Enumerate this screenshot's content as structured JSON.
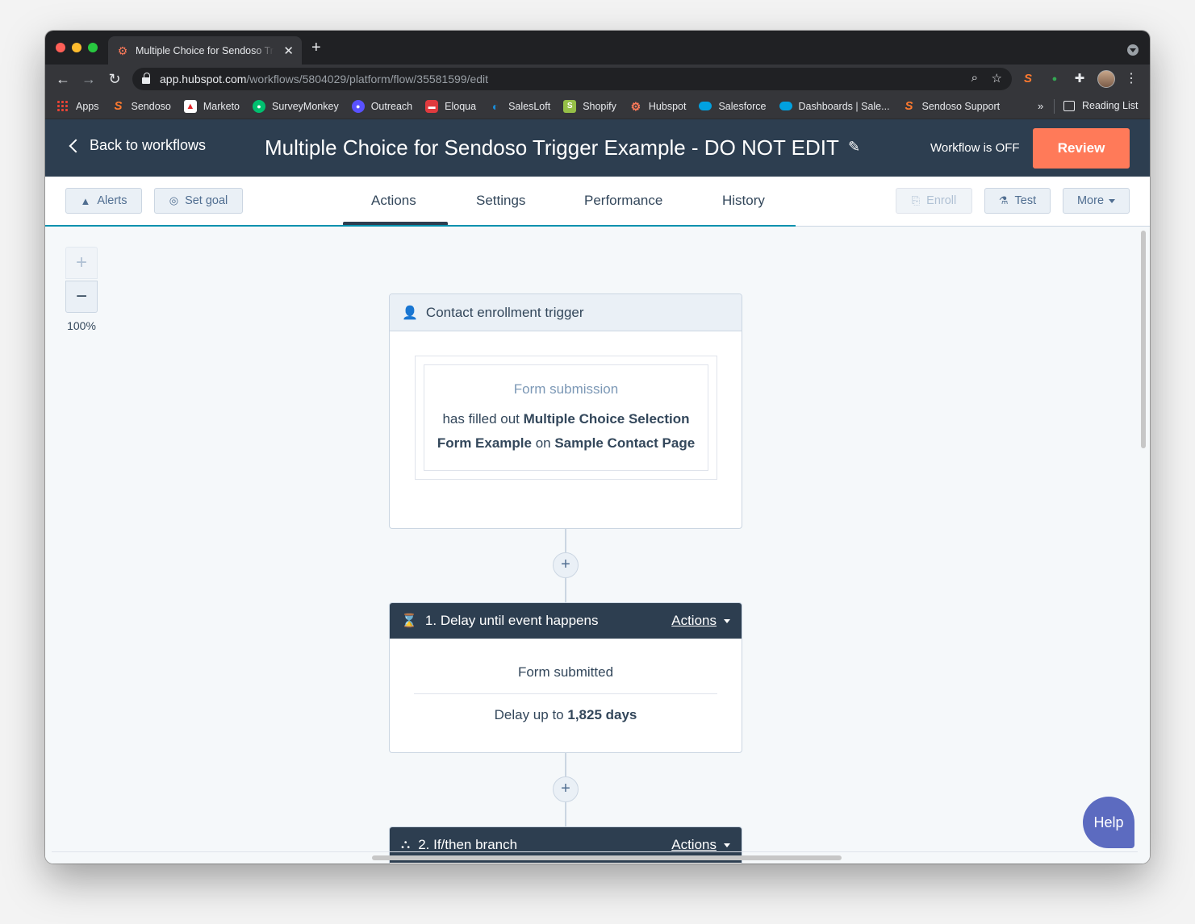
{
  "browser": {
    "tab_title": "Multiple Choice for Sendoso Trigger Example - DO NOT EDIT",
    "url_host": "app.hubspot.com",
    "url_path": "/workflows/5804029/platform/flow/35581599/edit",
    "bookmarks": [
      {
        "label": "Apps",
        "icon": "apps-grid-icon"
      },
      {
        "label": "Sendoso",
        "icon": "sendoso-icon"
      },
      {
        "label": "Marketo",
        "icon": "marketo-icon"
      },
      {
        "label": "SurveyMonkey",
        "icon": "surveymonkey-icon"
      },
      {
        "label": "Outreach",
        "icon": "outreach-icon"
      },
      {
        "label": "Eloqua",
        "icon": "eloqua-icon"
      },
      {
        "label": "SalesLoft",
        "icon": "salesloft-icon"
      },
      {
        "label": "Shopify",
        "icon": "shopify-icon"
      },
      {
        "label": "Hubspot",
        "icon": "hubspot-icon"
      },
      {
        "label": "Salesforce",
        "icon": "salesforce-icon"
      },
      {
        "label": "Dashboards | Sale...",
        "icon": "salesforce-icon"
      },
      {
        "label": "Sendoso Support",
        "icon": "sendoso-icon"
      }
    ],
    "bookmarks_overflow": "»",
    "reading_list": "Reading List"
  },
  "header": {
    "back_label": "Back to workflows",
    "title": "Multiple Choice for Sendoso Trigger Example - DO NOT EDIT",
    "status": "Workflow is OFF",
    "review_label": "Review",
    "accent_color": "#ff7a59",
    "header_bg": "#2d3e50"
  },
  "subbar": {
    "alerts_label": "Alerts",
    "goal_label": "Set goal",
    "tabs": [
      "Actions",
      "Settings",
      "Performance",
      "History"
    ],
    "active_tab": "Actions",
    "enroll_label": "Enroll",
    "test_label": "Test",
    "more_label": "More"
  },
  "canvas": {
    "zoom_in": "+",
    "zoom_out": "−",
    "zoom_level": "100%",
    "add_step": "+",
    "trigger": {
      "title": "Contact enrollment trigger",
      "filter_label": "Form submission",
      "text_prefix": "has filled out ",
      "form_name": "Multiple Choice Selection Form Example",
      "text_mid": " on ",
      "page_name": "Sample Contact Page"
    },
    "step1": {
      "title": "1. Delay until event happens",
      "actions_label": "Actions",
      "event": "Form submitted",
      "delay_prefix": "Delay up to ",
      "delay_value": "1,825 days"
    },
    "step2": {
      "title": "2. If/then branch",
      "actions_label": "Actions"
    }
  },
  "help_label": "Help"
}
